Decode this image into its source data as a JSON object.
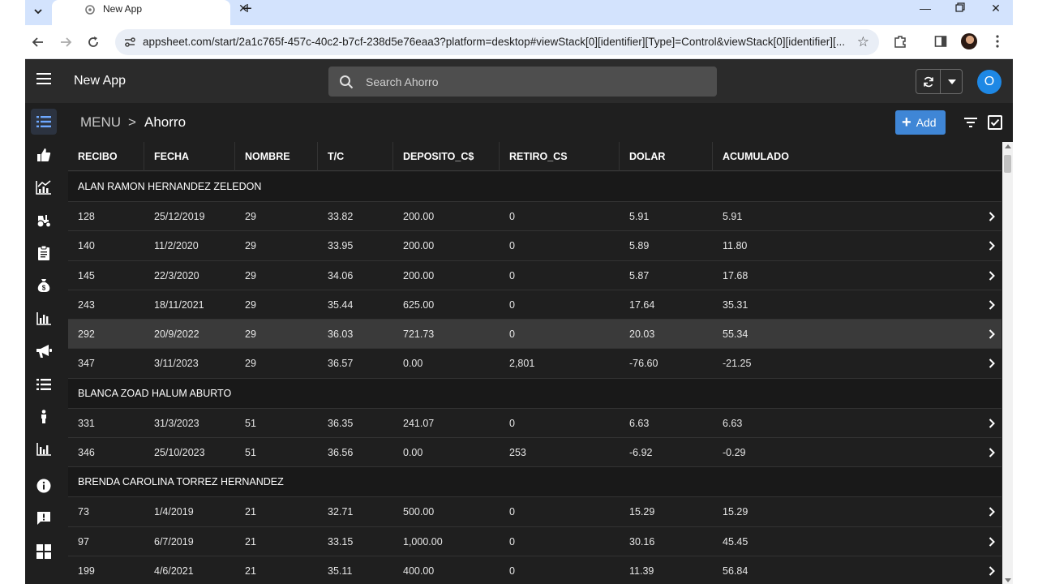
{
  "browser": {
    "tab_title": "New App",
    "url": "appsheet.com/start/2a1c765f-457c-40c2-b7cf-238d5e76eaa3?platform=desktop#viewStack[0][identifier][Type]=Control&viewStack[0][identifier][..."
  },
  "header": {
    "app_name": "New App",
    "search_placeholder": "Search Ahorro",
    "avatar_letter": "O"
  },
  "breadcrumb": {
    "menu": "MENU",
    "separator": ">",
    "title": "Ahorro"
  },
  "actions": {
    "add_label": "Add"
  },
  "table": {
    "columns": [
      "RECIBO",
      "FECHA",
      "NOMBRE",
      "T/C",
      "DEPOSITO_C$",
      "RETIRO_CS",
      "DOLAR",
      "ACUMULADO"
    ],
    "groups": [
      {
        "name": "ALAN RAMON HERNANDEZ ZELEDON",
        "rows": [
          [
            "128",
            "25/12/2019",
            "29",
            "33.82",
            "200.00",
            "0",
            "5.91",
            "5.91"
          ],
          [
            "140",
            "11/2/2020",
            "29",
            "33.95",
            "200.00",
            "0",
            "5.89",
            "11.80"
          ],
          [
            "145",
            "22/3/2020",
            "29",
            "34.06",
            "200.00",
            "0",
            "5.87",
            "17.68"
          ],
          [
            "243",
            "18/11/2021",
            "29",
            "35.44",
            "625.00",
            "0",
            "17.64",
            "35.31"
          ],
          [
            "292",
            "20/9/2022",
            "29",
            "36.03",
            "721.73",
            "0",
            "20.03",
            "55.34"
          ],
          [
            "347",
            "3/11/2023",
            "29",
            "36.57",
            "0.00",
            "2,801",
            "-76.60",
            "-21.25"
          ]
        ]
      },
      {
        "name": "BLANCA ZOAD HALUM ABURTO",
        "rows": [
          [
            "331",
            "31/3/2023",
            "51",
            "36.35",
            "241.07",
            "0",
            "6.63",
            "6.63"
          ],
          [
            "346",
            "25/10/2023",
            "51",
            "36.56",
            "0.00",
            "253",
            "-6.92",
            "-0.29"
          ]
        ]
      },
      {
        "name": "BRENDA CAROLINA TORREZ HERNANDEZ",
        "rows": [
          [
            "73",
            "1/4/2019",
            "21",
            "32.71",
            "500.00",
            "0",
            "15.29",
            "15.29"
          ],
          [
            "97",
            "6/7/2019",
            "21",
            "33.15",
            "1,000.00",
            "0",
            "30.16",
            "45.45"
          ],
          [
            "199",
            "4/6/2021",
            "21",
            "35.11",
            "400.00",
            "0",
            "11.39",
            "56.84"
          ]
        ]
      }
    ]
  },
  "rail_icons": [
    "list-icon",
    "thumbs-up-icon",
    "line-chart-icon",
    "tractor-icon",
    "clipboard-icon",
    "money-bag-icon",
    "bar-chart-icon",
    "megaphone-icon",
    "list-icon",
    "person-icon",
    "bar-chart-icon",
    "info-icon",
    "feedback-icon",
    "grid-icon"
  ],
  "colors": {
    "header_bg": "#2b2b2b",
    "content_bg": "#1f1f1f",
    "accent": "#3f86d6",
    "highlight_row": "#3a3a3a"
  }
}
